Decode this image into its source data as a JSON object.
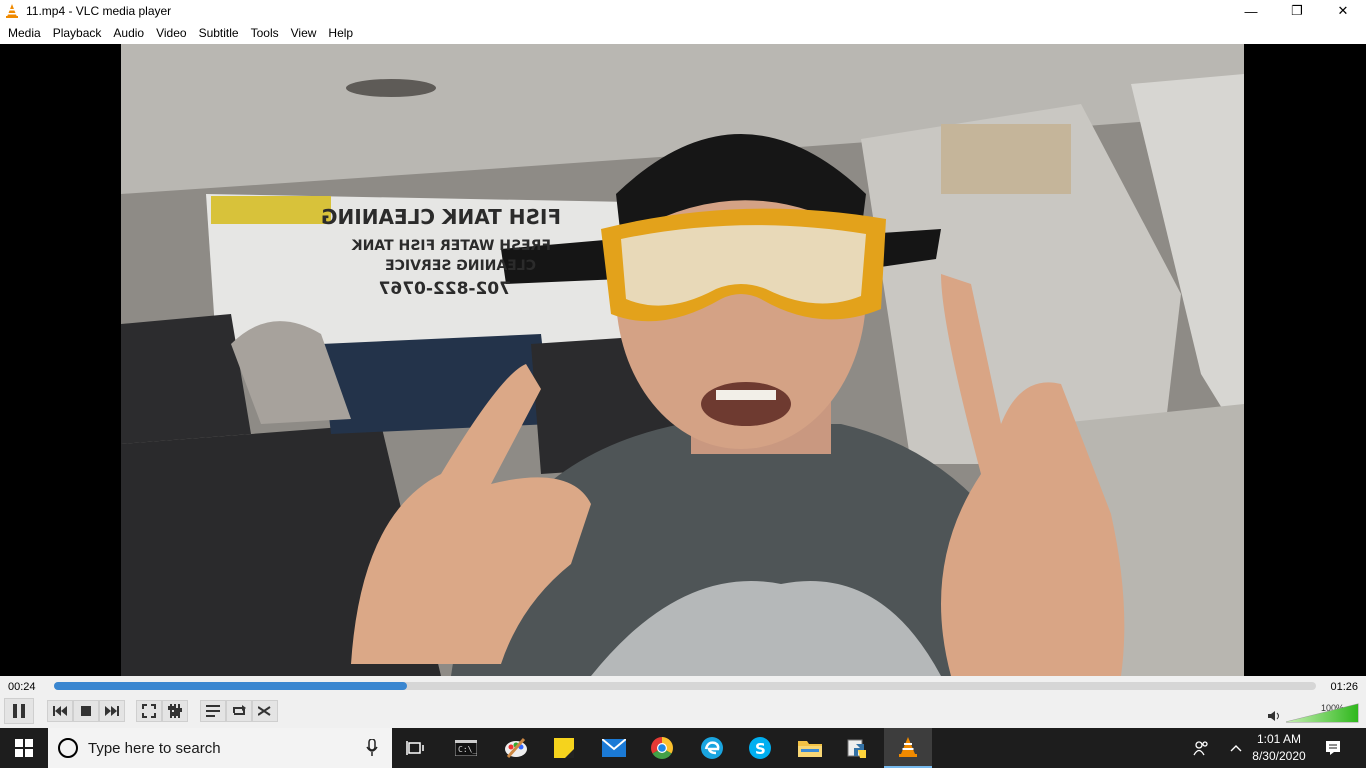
{
  "window": {
    "title": "11.mp4 - VLC media player",
    "controls": {
      "minimize": "—",
      "restore": "❐",
      "close": "✕"
    }
  },
  "menu": [
    "Media",
    "Playback",
    "Audio",
    "Video",
    "Subtitle",
    "Tools",
    "View",
    "Help"
  ],
  "video": {
    "sign_text": [
      "FISH TANK CLEANING",
      "FRESH WATER FISH TANK",
      "CLEANING SERVICE",
      "702-822-0767"
    ]
  },
  "player": {
    "elapsed": "00:24",
    "total": "01:26",
    "progress_fraction": 0.28,
    "volume_label": "100%",
    "volume_fraction": 1.0,
    "buttons": [
      "pause",
      "previous",
      "stop",
      "next",
      "fullscreen",
      "extended-settings",
      "playlist",
      "loop",
      "random"
    ]
  },
  "taskbar": {
    "search_placeholder": "Type here to search",
    "apps": [
      "task-view",
      "command-prompt",
      "paint",
      "sticky-notes",
      "mail",
      "chrome",
      "edge",
      "skype",
      "file-explorer",
      "python",
      "vlc"
    ],
    "active_app": "vlc",
    "time": "1:01 AM",
    "date": "8/30/2020"
  },
  "colors": {
    "accent": "#3a86d0",
    "taskbar": "#1d1d1d",
    "vlc_orange": "#f08a00"
  }
}
